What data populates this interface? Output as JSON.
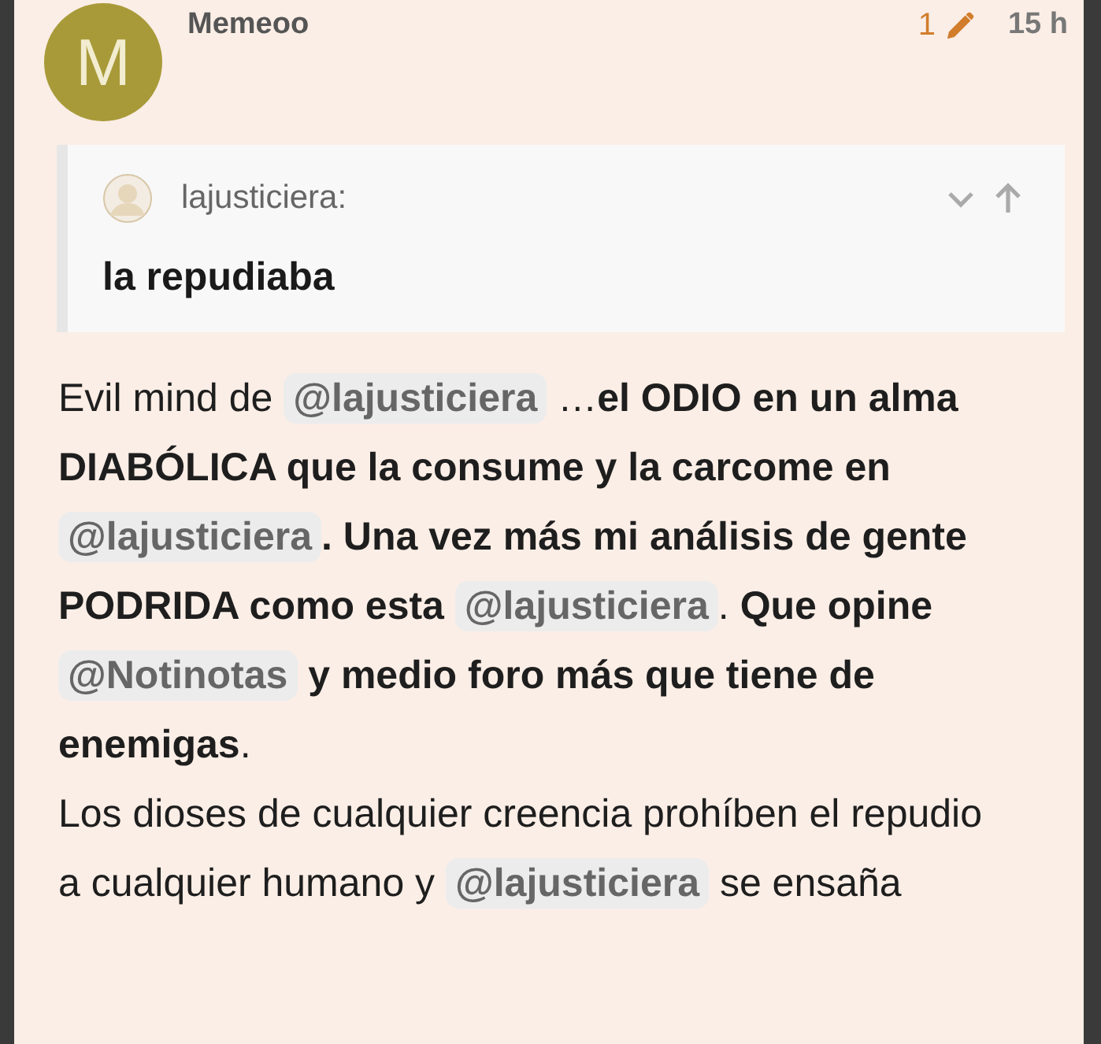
{
  "post": {
    "avatar_letter": "M",
    "username": "Memeoo",
    "edit_count": "1",
    "time": "15 h"
  },
  "quote": {
    "username": "lajusticiera:",
    "text": "la repudiaba"
  },
  "paragraphs": [
    [
      {
        "kind": "text",
        "text": "Evil mind de "
      },
      {
        "kind": "mention",
        "text": "@lajusticiera"
      },
      {
        "kind": "text",
        "text": " …"
      },
      {
        "kind": "bold",
        "text": "el ODIO en un alma DIABÓLICA que la consume y la carcome en "
      },
      {
        "kind": "mention",
        "text": "@lajusticiera"
      },
      {
        "kind": "bold",
        "text": ". Una vez más mi análisis de gente PODRIDA como esta "
      },
      {
        "kind": "mention",
        "text": "@lajusticiera"
      },
      {
        "kind": "text",
        "text": ". "
      },
      {
        "kind": "bold",
        "text": "Que opine "
      },
      {
        "kind": "mention",
        "text": "@Notinotas"
      },
      {
        "kind": "bold",
        "text": " y medio foro más que tiene de enemigas"
      },
      {
        "kind": "text",
        "text": "."
      }
    ],
    [
      {
        "kind": "text",
        "text": "Los dioses de cualquier creencia prohíben el repudio a cualquier humano y "
      },
      {
        "kind": "mention",
        "text": "@lajusticiera"
      },
      {
        "kind": "text",
        "text": " se ensaña"
      }
    ]
  ]
}
